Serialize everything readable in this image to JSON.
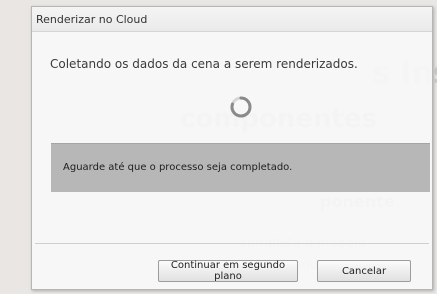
{
  "dialog": {
    "title": "Renderizar no Cloud",
    "status_text": "Coletando os dados da cena a serem renderizados.",
    "message": "Aguarde até que o processo seja completado.",
    "buttons": {
      "background_label": "Continuar em segundo plano",
      "cancel_label": "Cancelar"
    },
    "spinner_icon": "loading-spinner-icon"
  },
  "colors": {
    "message_box": "#b7b7b7",
    "window_bg": "#f8f8f8",
    "spinner": "#8a8a8a"
  }
}
